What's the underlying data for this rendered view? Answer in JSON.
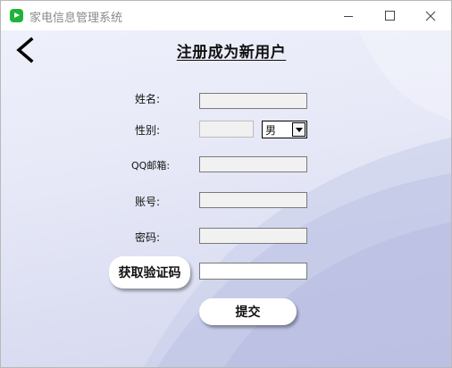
{
  "window": {
    "title": "家电信息管理系统"
  },
  "page": {
    "title": "注册成为新用户"
  },
  "form": {
    "name_label": "姓名:",
    "name_value": "",
    "gender_label": "性别:",
    "gender_text_value": "",
    "gender_selected": "男",
    "qq_email_label": "QQ邮箱:",
    "qq_email_value": "",
    "account_label": "账号:",
    "account_value": "",
    "password_label": "密码:",
    "password_value": "",
    "verification_code_value": "",
    "get_code_button": "获取验证码",
    "submit_button": "提交"
  },
  "icons": {
    "app": "app-icon",
    "back": "chevron-left-icon",
    "minimize": "minimize-icon",
    "maximize": "maximize-icon",
    "close": "close-icon",
    "dropdown": "caret-down-icon"
  },
  "colors": {
    "app_icon": "#1fb33a",
    "background": "#e4e6f6"
  }
}
